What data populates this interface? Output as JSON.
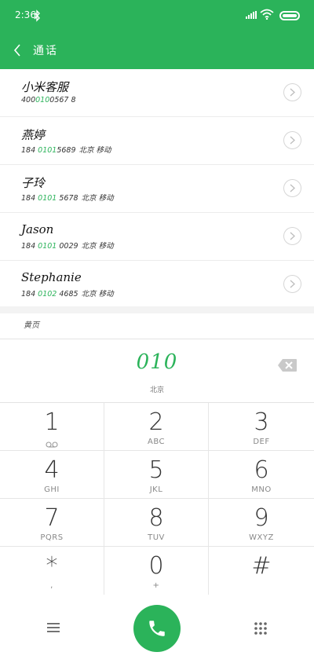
{
  "status_bar": {
    "time": "2:36"
  },
  "header": {
    "title": "通话"
  },
  "contacts": [
    {
      "name": "小米客服",
      "number_prefix": "400",
      "number_match": "010",
      "number_suffix": "0567 8",
      "location": ""
    },
    {
      "name": "燕婷",
      "number_prefix": "184 ",
      "number_match": "0101",
      "number_suffix": "5689",
      "location": "北京 移动"
    },
    {
      "name": "子玲",
      "number_prefix": "184 ",
      "number_match": "0101",
      "number_suffix": " 5678",
      "location": "北京 移动"
    },
    {
      "name": "Jason",
      "number_prefix": "184 ",
      "number_match": "0101",
      "number_suffix": " 0029",
      "location": "北京 移动"
    },
    {
      "name": "Stephanie",
      "number_prefix": "184 ",
      "number_match": "0102",
      "number_suffix": " 4685",
      "location": "北京 移动"
    }
  ],
  "section": {
    "label": "黄页"
  },
  "dial": {
    "number": "010",
    "location": "北京"
  },
  "keys": [
    {
      "digit": "1",
      "letters": ""
    },
    {
      "digit": "2",
      "letters": "ABC"
    },
    {
      "digit": "3",
      "letters": "DEF"
    },
    {
      "digit": "4",
      "letters": "GHI"
    },
    {
      "digit": "5",
      "letters": "JKL"
    },
    {
      "digit": "6",
      "letters": "MNO"
    },
    {
      "digit": "7",
      "letters": "PQRS"
    },
    {
      "digit": "8",
      "letters": "TUV"
    },
    {
      "digit": "9",
      "letters": "WXYZ"
    },
    {
      "digit": "*",
      "letters": ","
    },
    {
      "digit": "0",
      "letters": "+"
    },
    {
      "digit": "#",
      "letters": ""
    }
  ],
  "colors": {
    "accent": "#2bb35a"
  },
  "icons": {
    "back": "chevron-left-icon",
    "info": "chevron-right-icon",
    "voicemail": "voicemail-icon",
    "backspace": "backspace-icon",
    "menu": "menu-icon",
    "call": "phone-icon",
    "keypad": "dialpad-icon"
  }
}
